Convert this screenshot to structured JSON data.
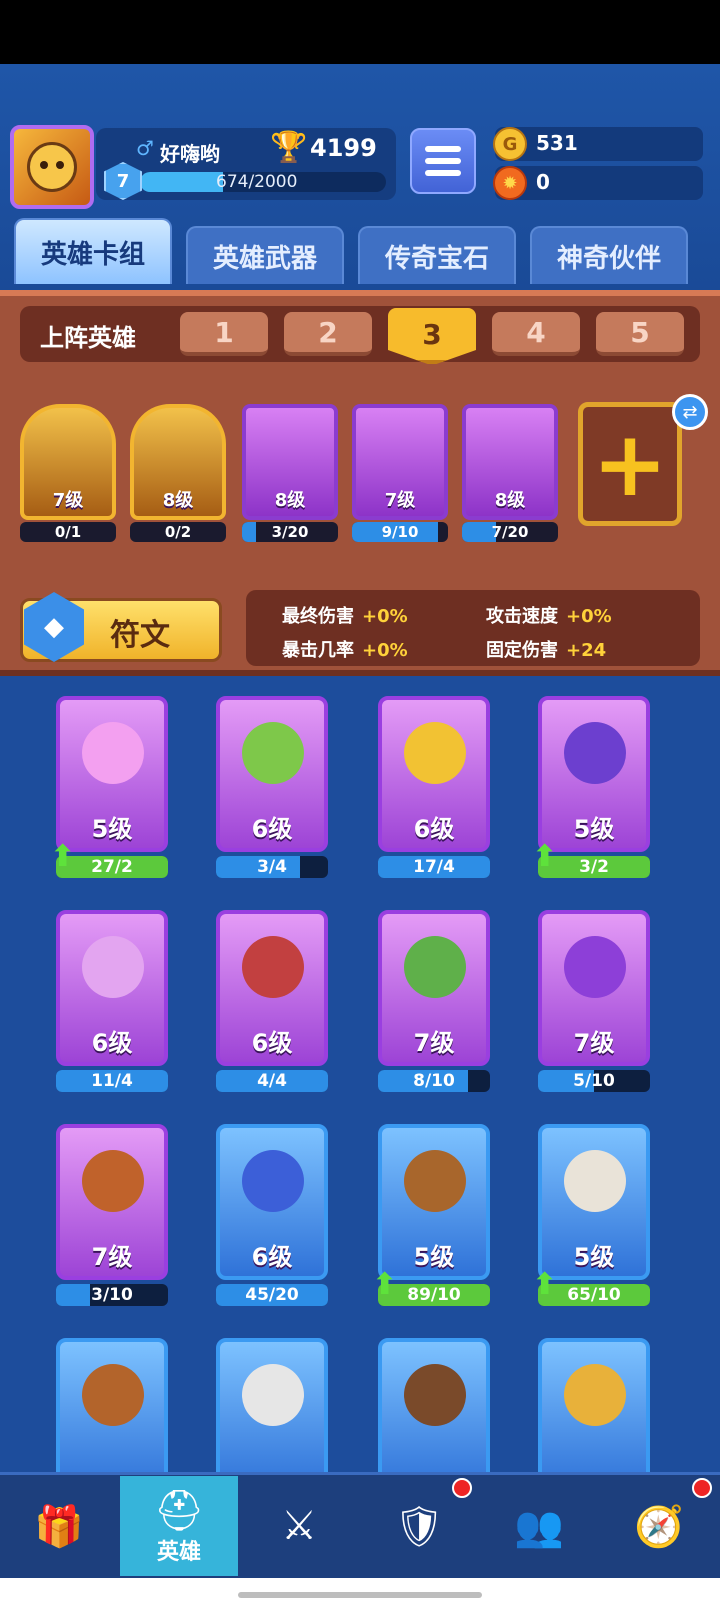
{
  "player": {
    "name": "好嗨哟",
    "gender_icon": "♂",
    "trophies": "4199",
    "level": "7",
    "xp_text": "674/2000",
    "xp_fraction": 0.337
  },
  "resources": {
    "gold": "531",
    "gems": "0"
  },
  "tabs": [
    "英雄卡组",
    "英雄武器",
    "传奇宝石",
    "神奇伙伴"
  ],
  "deck": {
    "label": "上阵英雄",
    "slots": [
      "1",
      "2",
      "3",
      "4",
      "5"
    ],
    "selected_slot": "3",
    "heroes": [
      {
        "level": "7级",
        "progress": "0/1",
        "fill": 0.0,
        "frame": "gold"
      },
      {
        "level": "8级",
        "progress": "0/2",
        "fill": 0.0,
        "frame": "gold"
      },
      {
        "level": "8级",
        "progress": "3/20",
        "fill": 0.15,
        "frame": "purple"
      },
      {
        "level": "7级",
        "progress": "9/10",
        "fill": 0.9,
        "frame": "purple"
      },
      {
        "level": "8级",
        "progress": "7/20",
        "fill": 0.35,
        "frame": "purple"
      }
    ]
  },
  "rune": {
    "label": "符文"
  },
  "stats": [
    {
      "label": "最终伤害",
      "value": "+0%"
    },
    {
      "label": "攻击速度",
      "value": "+0%"
    },
    {
      "label": "暴击几率",
      "value": "+0%"
    },
    {
      "label": "固定伤害",
      "value": "+24"
    }
  ],
  "collection": [
    {
      "level": "5级",
      "progress": "27/2",
      "fill": 1.0,
      "upgrade": true,
      "frame": "purple",
      "color": "#f3a0f0"
    },
    {
      "level": "6级",
      "progress": "3/4",
      "fill": 0.75,
      "upgrade": false,
      "frame": "purple",
      "color": "#7ec84a"
    },
    {
      "level": "6级",
      "progress": "17/4",
      "fill": 1.0,
      "upgrade": false,
      "frame": "purple",
      "color": "#f2c233"
    },
    {
      "level": "5级",
      "progress": "3/2",
      "fill": 1.0,
      "upgrade": true,
      "frame": "purple",
      "color": "#6c3fcf"
    },
    {
      "level": "6级",
      "progress": "11/4",
      "fill": 1.0,
      "upgrade": false,
      "frame": "purple",
      "color": "#e3a5f0"
    },
    {
      "level": "6级",
      "progress": "4/4",
      "fill": 1.0,
      "upgrade": false,
      "frame": "purple",
      "color": "#c24040"
    },
    {
      "level": "7级",
      "progress": "8/10",
      "fill": 0.8,
      "upgrade": false,
      "frame": "purple",
      "color": "#5fb04a"
    },
    {
      "level": "7级",
      "progress": "5/10",
      "fill": 0.5,
      "upgrade": false,
      "frame": "purple",
      "color": "#8d3fd8"
    },
    {
      "level": "7级",
      "progress": "3/10",
      "fill": 0.3,
      "upgrade": false,
      "frame": "purple",
      "color": "#c0622b"
    },
    {
      "level": "6级",
      "progress": "45/20",
      "fill": 1.0,
      "upgrade": false,
      "frame": "blue",
      "color": "#3c5fd8"
    },
    {
      "level": "5级",
      "progress": "89/10",
      "fill": 1.0,
      "upgrade": true,
      "frame": "blue",
      "color": "#a8662c"
    },
    {
      "level": "5级",
      "progress": "65/10",
      "fill": 1.0,
      "upgrade": true,
      "frame": "blue",
      "color": "#e9e3d8"
    },
    {
      "level": "",
      "progress": "",
      "fill": 0,
      "upgrade": false,
      "frame": "blue",
      "color": "#b3642b"
    },
    {
      "level": "",
      "progress": "",
      "fill": 0,
      "upgrade": false,
      "frame": "blue",
      "color": "#e6e6e6"
    },
    {
      "level": "",
      "progress": "",
      "fill": 0,
      "upgrade": false,
      "frame": "blue",
      "color": "#7a4a2a"
    },
    {
      "level": "",
      "progress": "",
      "fill": 0,
      "upgrade": false,
      "frame": "blue",
      "color": "#e8b13a"
    }
  ],
  "nav": [
    {
      "icon": "treasure-chest-icon",
      "label": "",
      "active": false,
      "badge": false
    },
    {
      "icon": "knight-helmet-icon",
      "label": "英雄",
      "active": true,
      "badge": false
    },
    {
      "icon": "crossed-swords-icon",
      "label": "",
      "active": false,
      "badge": false
    },
    {
      "icon": "crown-shield-icon",
      "label": "",
      "active": false,
      "badge": true
    },
    {
      "icon": "group-icon",
      "label": "",
      "active": false,
      "badge": false
    },
    {
      "icon": "compass-icon",
      "label": "",
      "active": false,
      "badge": true
    }
  ]
}
